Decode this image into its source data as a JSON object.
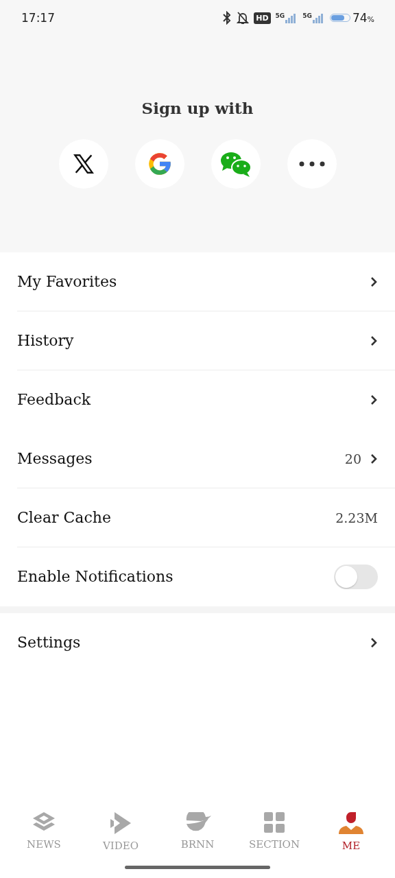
{
  "status_bar": {
    "time": "17:17",
    "hd_badge": "HD",
    "signals": [
      {
        "label": "5G"
      },
      {
        "label": "5G"
      }
    ],
    "battery": {
      "level": 0.74,
      "percent": "74",
      "unit": "%"
    }
  },
  "signup": {
    "title": "Sign up with",
    "providers": [
      {
        "kind": "x"
      },
      {
        "kind": "google"
      },
      {
        "kind": "wechat"
      },
      {
        "kind": "more"
      }
    ]
  },
  "menu": [
    {
      "label": "My Favorites",
      "kind": "link",
      "divider": true
    },
    {
      "label": "History",
      "kind": "link",
      "divider": true
    },
    {
      "label": "Feedback",
      "kind": "link",
      "divider": false
    },
    {
      "label": "Messages",
      "kind": "link",
      "value": "20",
      "divider": true
    },
    {
      "label": "Clear Cache",
      "kind": "value",
      "value": "2.23M",
      "divider": true
    },
    {
      "label": "Enable Notifications",
      "kind": "toggle",
      "on": false,
      "divider": false
    }
  ],
  "menu_2": [
    {
      "label": "Settings",
      "kind": "link",
      "divider": false
    }
  ],
  "tab_bar": [
    {
      "label": "NEWS",
      "selected": false
    },
    {
      "label": "VIDEO",
      "selected": false
    },
    {
      "label": "BRNN",
      "selected": false
    },
    {
      "label": "SECTION",
      "selected": false
    },
    {
      "label": "ME",
      "selected": true
    }
  ]
}
